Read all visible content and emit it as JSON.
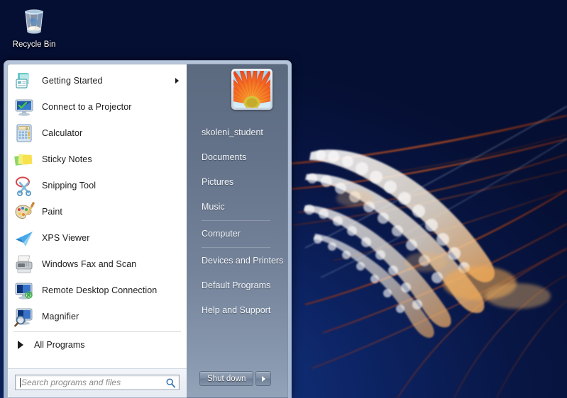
{
  "desktop": {
    "wallpaper_name": "jellyfish-wallpaper",
    "background_color": "#0a1a4f",
    "icons": [
      {
        "name": "recycle-bin",
        "label": "Recycle Bin",
        "icon": "recycle-bin-icon"
      }
    ]
  },
  "start_menu": {
    "programs": [
      {
        "label": "Getting Started",
        "icon": "getting-started-icon",
        "has_submenu": true
      },
      {
        "label": "Connect to a Projector",
        "icon": "projector-icon",
        "has_submenu": false
      },
      {
        "label": "Calculator",
        "icon": "calculator-icon",
        "has_submenu": false
      },
      {
        "label": "Sticky Notes",
        "icon": "sticky-notes-icon",
        "has_submenu": false
      },
      {
        "label": "Snipping Tool",
        "icon": "snipping-tool-icon",
        "has_submenu": false
      },
      {
        "label": "Paint",
        "icon": "paint-icon",
        "has_submenu": false
      },
      {
        "label": "XPS Viewer",
        "icon": "xps-viewer-icon",
        "has_submenu": false
      },
      {
        "label": "Windows Fax and Scan",
        "icon": "fax-scan-icon",
        "has_submenu": false
      },
      {
        "label": "Remote Desktop Connection",
        "icon": "remote-desktop-icon",
        "has_submenu": false
      },
      {
        "label": "Magnifier",
        "icon": "magnifier-icon",
        "has_submenu": false
      }
    ],
    "all_programs": {
      "label": "All Programs",
      "icon": "right-arrow-icon"
    },
    "search": {
      "placeholder": "Search programs and files",
      "value": "",
      "icon": "search-icon"
    },
    "user": {
      "name": "skoleni_student",
      "avatar": "flower-avatar"
    },
    "places": [
      {
        "label": "Documents",
        "separator_after": false
      },
      {
        "label": "Pictures",
        "separator_after": false
      },
      {
        "label": "Music",
        "separator_after": true
      },
      {
        "label": "Computer",
        "separator_after": true
      },
      {
        "label": "Devices and Printers",
        "separator_after": false
      },
      {
        "label": "Default Programs",
        "separator_after": false
      },
      {
        "label": "Help and Support",
        "separator_after": false
      }
    ],
    "shutdown": {
      "label": "Shut down",
      "arrow_icon": "chevron-right-icon"
    },
    "colors": {
      "left_pane_bg": "#ffffff",
      "right_pane_top": "#5b6a7f",
      "right_pane_bottom": "#93a3b8",
      "frame": "#bccade",
      "text_dark": "#202020",
      "text_light": "#f4f7fb"
    }
  }
}
